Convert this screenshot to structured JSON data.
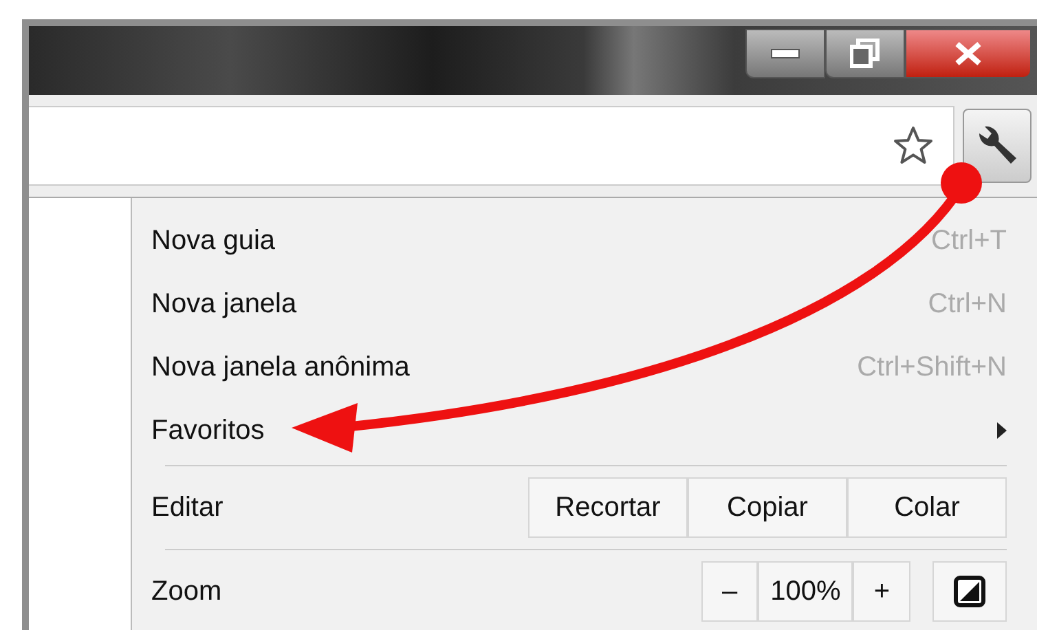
{
  "menu": [
    {
      "kind": "item",
      "label": "Nova guia",
      "shortcut": "Ctrl+T"
    },
    {
      "kind": "item",
      "label": "Nova janela",
      "shortcut": "Ctrl+N"
    },
    {
      "kind": "item",
      "label": "Nova janela anônima",
      "shortcut": "Ctrl+Shift+N"
    },
    {
      "kind": "submenu",
      "label": "Favoritos"
    },
    {
      "kind": "separator"
    },
    {
      "kind": "edit",
      "label": "Editar",
      "buttons": [
        "Recortar",
        "Copiar",
        "Colar"
      ]
    },
    {
      "kind": "separator"
    },
    {
      "kind": "zoom",
      "label": "Zoom",
      "decrease": "–",
      "value": "100%",
      "increase": "+"
    }
  ]
}
